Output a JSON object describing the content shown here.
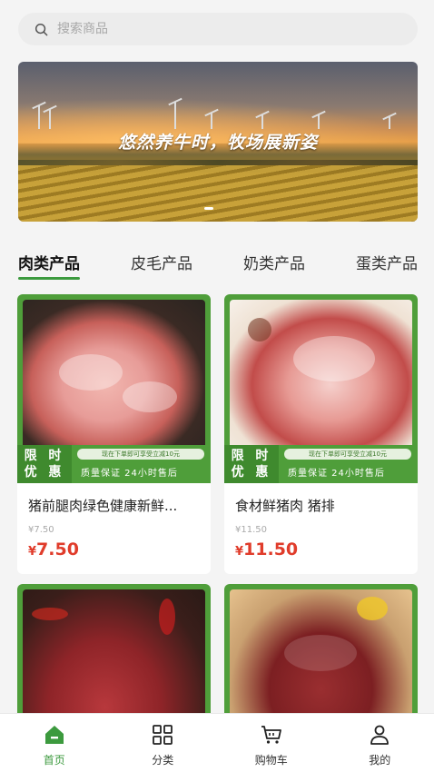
{
  "search": {
    "placeholder": "搜索商品"
  },
  "banner": {
    "title": "悠然养牛时，牧场展新姿"
  },
  "tabs": [
    {
      "label": "肉类产品",
      "active": true
    },
    {
      "label": "皮毛产品"
    },
    {
      "label": "奶类产品"
    },
    {
      "label": "蛋类产品"
    }
  ],
  "promo": {
    "tag_line1": "限 时",
    "tag_line2": "优 惠",
    "note": "现在下单即可享受立减10元",
    "guarantee": "质量保证 24小时售后"
  },
  "products": [
    {
      "name": "猪前腿肉绿色健康新鲜...",
      "old_price": "¥7.50",
      "currency": "¥",
      "price": "7.50"
    },
    {
      "name": "食材鲜猪肉 猪排",
      "old_price": "¥11.50",
      "currency": "¥",
      "price": "11.50"
    },
    {
      "name": "",
      "old_price": "",
      "currency": "",
      "price": ""
    },
    {
      "name": "",
      "old_price": "",
      "currency": "",
      "price": ""
    }
  ],
  "nav": [
    {
      "label": "首页",
      "icon": "home-icon",
      "active": true
    },
    {
      "label": "分类",
      "icon": "category-icon"
    },
    {
      "label": "购物车",
      "icon": "cart-icon"
    },
    {
      "label": "我的",
      "icon": "user-icon"
    }
  ],
  "colors": {
    "accent": "#3c9a3e",
    "price": "#e03c2b",
    "promo": "#4f9e3a"
  }
}
